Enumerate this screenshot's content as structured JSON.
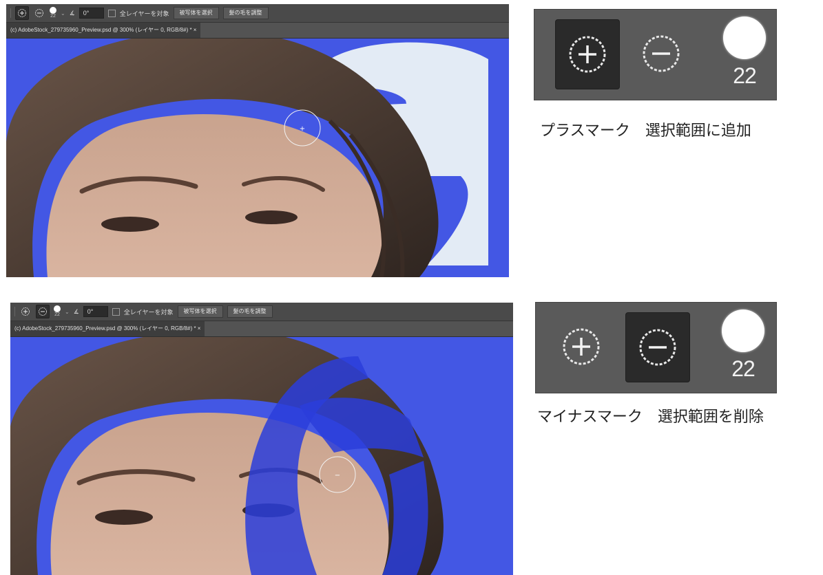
{
  "colors": {
    "canvas_blue": "#4357e4",
    "brush_stroke": "#2a3ddb",
    "panel_bg": "#5a5a5a",
    "option_bar_bg": "#4a4a4a"
  },
  "screenshots": [
    {
      "id": "top",
      "options_bar": {
        "mode_active": "add",
        "brush_size": "22",
        "angle_value": "0°",
        "sample_all_layers_label": "全レイヤーを対象",
        "select_subject_label": "被写体を選択",
        "refine_hair_label": "髪の毛を調整"
      },
      "document_tab": "(c) AdobeStock_279735960_Preview.psd @ 300% (レイヤー 0, RGB/8#) * ×",
      "cursor_symbol": "+"
    },
    {
      "id": "bottom",
      "options_bar": {
        "mode_active": "subtract",
        "brush_size": "22",
        "angle_value": "0°",
        "sample_all_layers_label": "全レイヤーを対象",
        "select_subject_label": "被写体を選択",
        "refine_hair_label": "髪の毛を調整"
      },
      "document_tab": "(c) AdobeStock_279735960_Preview.psd @ 300% (レイヤー 0, RGB/8#) * ×",
      "cursor_symbol": "−"
    }
  ],
  "panels": [
    {
      "id": "add",
      "active_button": "plus",
      "brush_size": "22",
      "caption": "プラスマーク　選択範囲に追加"
    },
    {
      "id": "remove",
      "active_button": "minus",
      "brush_size": "22",
      "caption": "マイナスマーク　選択範囲を削除"
    }
  ]
}
